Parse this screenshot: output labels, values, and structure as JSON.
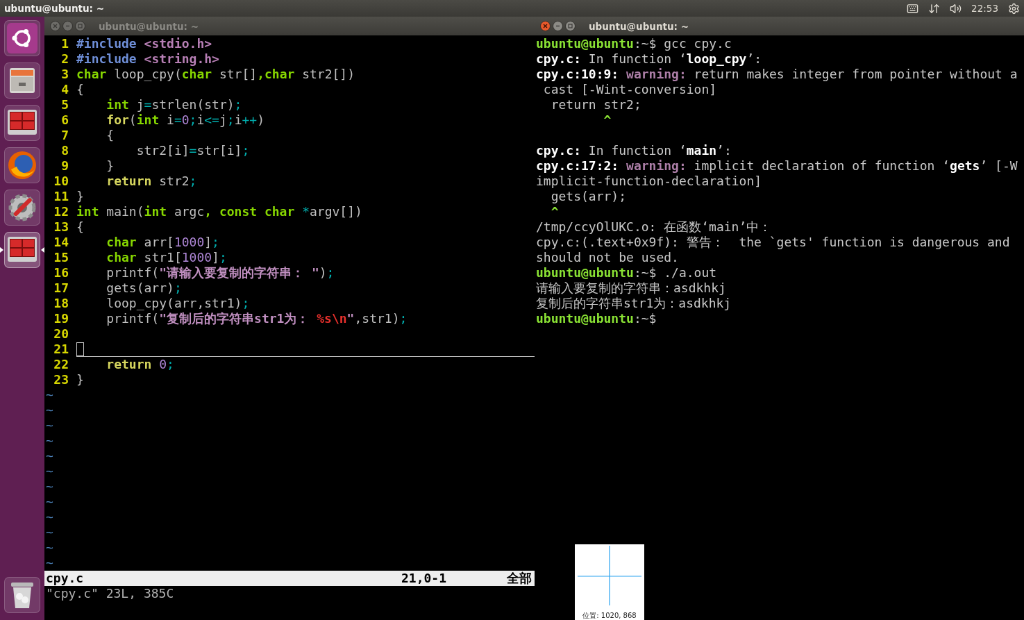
{
  "top_bar": {
    "title": "ubuntu@ubuntu: ~",
    "clock": "22:53"
  },
  "launcher": {
    "items": [
      {
        "kind": "ubuntu",
        "active": false
      },
      {
        "kind": "files",
        "active": false
      },
      {
        "kind": "terminal",
        "active": false
      },
      {
        "kind": "browser",
        "active": false
      },
      {
        "kind": "settings",
        "active": false
      },
      {
        "kind": "terminal",
        "active": true
      },
      {
        "kind": "trash",
        "active": false
      }
    ]
  },
  "editor": {
    "title": "ubuntu@ubuntu: ~",
    "focused": false,
    "lines": [
      {
        "number": "1",
        "cursor": false,
        "segments": [
          {
            "kind": "pre",
            "text": "#include"
          },
          {
            "kind": "inc",
            "text": " <stdio.h>"
          }
        ]
      },
      {
        "number": "2",
        "cursor": false,
        "segments": [
          {
            "kind": "pre",
            "text": "#include"
          },
          {
            "kind": "inc",
            "text": " <string.h>"
          }
        ]
      },
      {
        "number": "3",
        "cursor": false,
        "segments": [
          {
            "kind": "type",
            "text": "char"
          },
          {
            "kind": "p",
            "text": " loop_cpy("
          },
          {
            "kind": "type",
            "text": "char"
          },
          {
            "kind": "p",
            "text": " str[]"
          },
          {
            "kind": "type",
            "text": ",char"
          },
          {
            "kind": "p",
            "text": " str2[])"
          }
        ]
      },
      {
        "number": "4",
        "cursor": false,
        "segments": [
          {
            "kind": "p",
            "text": "{"
          }
        ]
      },
      {
        "number": "5",
        "cursor": false,
        "segments": [
          {
            "kind": "type",
            "text": "    int"
          },
          {
            "kind": "p",
            "text": " j"
          },
          {
            "kind": "op",
            "text": "="
          },
          {
            "kind": "p",
            "text": "strlen(str)"
          },
          {
            "kind": "op",
            "text": ";"
          }
        ]
      },
      {
        "number": "6",
        "cursor": false,
        "segments": [
          {
            "kind": "kw",
            "text": "    for"
          },
          {
            "kind": "p",
            "text": "("
          },
          {
            "kind": "type",
            "text": "int"
          },
          {
            "kind": "p",
            "text": " i"
          },
          {
            "kind": "op",
            "text": "="
          },
          {
            "kind": "num",
            "text": "0"
          },
          {
            "kind": "op",
            "text": ";"
          },
          {
            "kind": "p",
            "text": "i"
          },
          {
            "kind": "op",
            "text": "<="
          },
          {
            "kind": "p",
            "text": "j"
          },
          {
            "kind": "op",
            "text": ";"
          },
          {
            "kind": "p",
            "text": "i"
          },
          {
            "kind": "op",
            "text": "++"
          },
          {
            "kind": "p",
            "text": ")"
          }
        ]
      },
      {
        "number": "7",
        "cursor": false,
        "segments": [
          {
            "kind": "p",
            "text": "    {"
          }
        ]
      },
      {
        "number": "8",
        "cursor": false,
        "segments": [
          {
            "kind": "p",
            "text": "        str2[i]"
          },
          {
            "kind": "op",
            "text": "="
          },
          {
            "kind": "p",
            "text": "str[i]"
          },
          {
            "kind": "op",
            "text": ";"
          }
        ]
      },
      {
        "number": "9",
        "cursor": false,
        "segments": [
          {
            "kind": "p",
            "text": "    }"
          }
        ]
      },
      {
        "number": "10",
        "cursor": false,
        "segments": [
          {
            "kind": "kw",
            "text": "    return"
          },
          {
            "kind": "p",
            "text": " str2"
          },
          {
            "kind": "op",
            "text": ";"
          }
        ]
      },
      {
        "number": "11",
        "cursor": false,
        "segments": [
          {
            "kind": "p",
            "text": "}"
          }
        ]
      },
      {
        "number": "12",
        "cursor": false,
        "segments": [
          {
            "kind": "type",
            "text": "int"
          },
          {
            "kind": "p",
            "text": " main("
          },
          {
            "kind": "type",
            "text": "int"
          },
          {
            "kind": "p",
            "text": " argc"
          },
          {
            "kind": "type",
            "text": ", const char"
          },
          {
            "kind": "op",
            "text": " *"
          },
          {
            "kind": "p",
            "text": "argv[])"
          }
        ]
      },
      {
        "number": "13",
        "cursor": false,
        "segments": [
          {
            "kind": "p",
            "text": "{"
          }
        ]
      },
      {
        "number": "14",
        "cursor": false,
        "segments": [
          {
            "kind": "type",
            "text": "    char"
          },
          {
            "kind": "p",
            "text": " arr["
          },
          {
            "kind": "num",
            "text": "1000"
          },
          {
            "kind": "p",
            "text": "]"
          },
          {
            "kind": "op",
            "text": ";"
          }
        ]
      },
      {
        "number": "15",
        "cursor": false,
        "segments": [
          {
            "kind": "type",
            "text": "    char"
          },
          {
            "kind": "p",
            "text": " str1["
          },
          {
            "kind": "num",
            "text": "1000"
          },
          {
            "kind": "p",
            "text": "]"
          },
          {
            "kind": "op",
            "text": ";"
          }
        ]
      },
      {
        "number": "16",
        "cursor": false,
        "segments": [
          {
            "kind": "p",
            "text": "    printf("
          },
          {
            "kind": "str",
            "text": "\"请输入要复制的字符串： \""
          },
          {
            "kind": "p",
            "text": ")"
          },
          {
            "kind": "op",
            "text": ";"
          }
        ]
      },
      {
        "number": "17",
        "cursor": false,
        "segments": [
          {
            "kind": "p",
            "text": "    gets(arr)"
          },
          {
            "kind": "op",
            "text": ";"
          }
        ]
      },
      {
        "number": "18",
        "cursor": false,
        "segments": [
          {
            "kind": "p",
            "text": "    loop_cpy(arr,str1)"
          },
          {
            "kind": "op",
            "text": ";"
          }
        ]
      },
      {
        "number": "19",
        "cursor": false,
        "segments": [
          {
            "kind": "p",
            "text": "    printf("
          },
          {
            "kind": "str",
            "text": "\"复制后的字符串str1为： "
          },
          {
            "kind": "esc",
            "text": "%s\\n"
          },
          {
            "kind": "str",
            "text": "\""
          },
          {
            "kind": "p",
            "text": ",str1)"
          },
          {
            "kind": "op",
            "text": ";"
          }
        ]
      },
      {
        "number": "20",
        "cursor": false
      },
      {
        "number": "21",
        "cursor": true
      },
      {
        "number": "22",
        "cursor": false,
        "segments": [
          {
            "kind": "kw",
            "text": "    return"
          },
          {
            "kind": "num",
            "text": " 0"
          },
          {
            "kind": "op",
            "text": ";"
          }
        ]
      },
      {
        "number": "23",
        "cursor": false,
        "segments": [
          {
            "kind": "p",
            "text": "}"
          }
        ]
      }
    ],
    "filler": [
      "~",
      "~",
      "~",
      "~",
      "~",
      "~",
      "~",
      "~",
      "~",
      "~",
      "~",
      "~"
    ],
    "status": {
      "file": "cpy.c",
      "position": "21,0-1",
      "scroll": "全部"
    },
    "message": "\"cpy.c\" 23L, 385C"
  },
  "terminal": {
    "title": "ubuntu@ubuntu: ~",
    "focused": true,
    "lines": [
      {
        "segments": [
          {
            "kind": "prompt",
            "text": "ubuntu@ubuntu"
          },
          {
            "kind": "p",
            "text": ":~$ gcc cpy.c"
          }
        ]
      },
      {
        "segments": [
          {
            "kind": "bold",
            "text": "cpy.c:"
          },
          {
            "kind": "p",
            "text": " In function ‘"
          },
          {
            "kind": "bold",
            "text": "loop_cpy"
          },
          {
            "kind": "p",
            "text": "’:"
          }
        ]
      },
      {
        "segments": [
          {
            "kind": "bold",
            "text": "cpy.c:10:9:"
          },
          {
            "kind": "warning",
            "text": " warning:"
          },
          {
            "kind": "p",
            "text": " return makes integer from pointer without a"
          }
        ]
      },
      {
        "segments": [
          {
            "kind": "p",
            "text": " cast [-Wint-conversion]"
          }
        ]
      },
      {
        "segments": [
          {
            "kind": "p",
            "text": "  return str2;"
          }
        ]
      },
      {
        "segments": [
          {
            "kind": "caret",
            "text": "         ^"
          }
        ]
      },
      {
        "kind": "blank"
      },
      {
        "segments": [
          {
            "kind": "bold",
            "text": "cpy.c:"
          },
          {
            "kind": "p",
            "text": " In function ‘"
          },
          {
            "kind": "bold",
            "text": "main"
          },
          {
            "kind": "p",
            "text": "’:"
          }
        ]
      },
      {
        "segments": [
          {
            "kind": "bold",
            "text": "cpy.c:17:2:"
          },
          {
            "kind": "warning",
            "text": " warning:"
          },
          {
            "kind": "p",
            "text": " implicit declaration of function ‘"
          },
          {
            "kind": "bold",
            "text": "gets"
          },
          {
            "kind": "p",
            "text": "’ [-W"
          }
        ]
      },
      {
        "segments": [
          {
            "kind": "p",
            "text": "implicit-function-declaration]"
          }
        ]
      },
      {
        "segments": [
          {
            "kind": "p",
            "text": "  gets(arr);"
          }
        ]
      },
      {
        "segments": [
          {
            "kind": "caret",
            "text": "  ^"
          }
        ]
      },
      {
        "segments": [
          {
            "kind": "p",
            "text": "/tmp/ccyOlUKC.o: 在函数‘main’中："
          }
        ]
      },
      {
        "segments": [
          {
            "kind": "p",
            "text": "cpy.c:(.text+0x9f): 警告：  the `gets' function is dangerous and"
          }
        ]
      },
      {
        "segments": [
          {
            "kind": "p",
            "text": "should not be used."
          }
        ]
      },
      {
        "segments": [
          {
            "kind": "prompt",
            "text": "ubuntu@ubuntu"
          },
          {
            "kind": "p",
            "text": ":~$ ./a.out"
          }
        ]
      },
      {
        "segments": [
          {
            "kind": "p",
            "text": "请输入要复制的字符串：asdkhkj"
          }
        ]
      },
      {
        "segments": [
          {
            "kind": "p",
            "text": "复制后的字符串str1为：asdkhkj"
          }
        ]
      },
      {
        "segments": [
          {
            "kind": "prompt",
            "text": "ubuntu@ubuntu"
          },
          {
            "kind": "p",
            "text": ":~$"
          }
        ]
      }
    ]
  },
  "magnifier": {
    "caption": "位置: 1020, 868"
  }
}
